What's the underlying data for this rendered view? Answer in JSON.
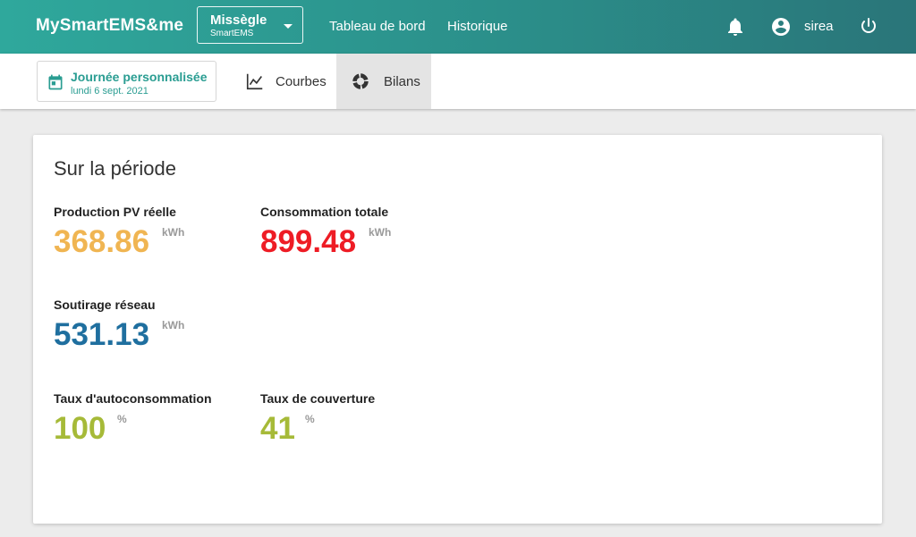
{
  "topbar": {
    "brand": "MySmartEMS&me",
    "site": {
      "name": "Missègle",
      "subtitle": "SmartEMS"
    },
    "nav": {
      "dashboard": "Tableau de bord",
      "history": "Historique"
    },
    "user": {
      "name": "sirea"
    },
    "icons": {
      "notifications": "bell-icon",
      "account": "account-circle-icon",
      "logout": "power-icon"
    }
  },
  "subbar": {
    "date_picker": {
      "title": "Journée personnalisée",
      "date": "lundi 6 sept. 2021",
      "icon": "calendar-icon"
    },
    "tabs": [
      {
        "label": "Courbes",
        "icon": "line-chart-icon",
        "active": false
      },
      {
        "label": "Bilans",
        "icon": "donut-chart-icon",
        "active": true
      }
    ]
  },
  "summary": {
    "title": "Sur la période",
    "metrics": [
      {
        "label": "Production PV réelle",
        "value": "368.86",
        "unit": "kWh",
        "color": "#f0b552"
      },
      {
        "label": "Consommation totale",
        "value": "899.48",
        "unit": "kWh",
        "color": "#ee1c25"
      },
      {
        "label": "Soutirage réseau",
        "value": "531.13",
        "unit": "kWh",
        "color": "#1f6f9f"
      },
      {
        "label": "Taux d'autoconsommation",
        "value": "100",
        "unit": "%",
        "color": "#a6ba38"
      },
      {
        "label": "Taux de couverture",
        "value": "41",
        "unit": "%",
        "color": "#a6ba38"
      }
    ]
  },
  "colors": {
    "topbar_start": "#2fa89c",
    "topbar_end": "#2a7579",
    "accent": "#2a9d92"
  }
}
